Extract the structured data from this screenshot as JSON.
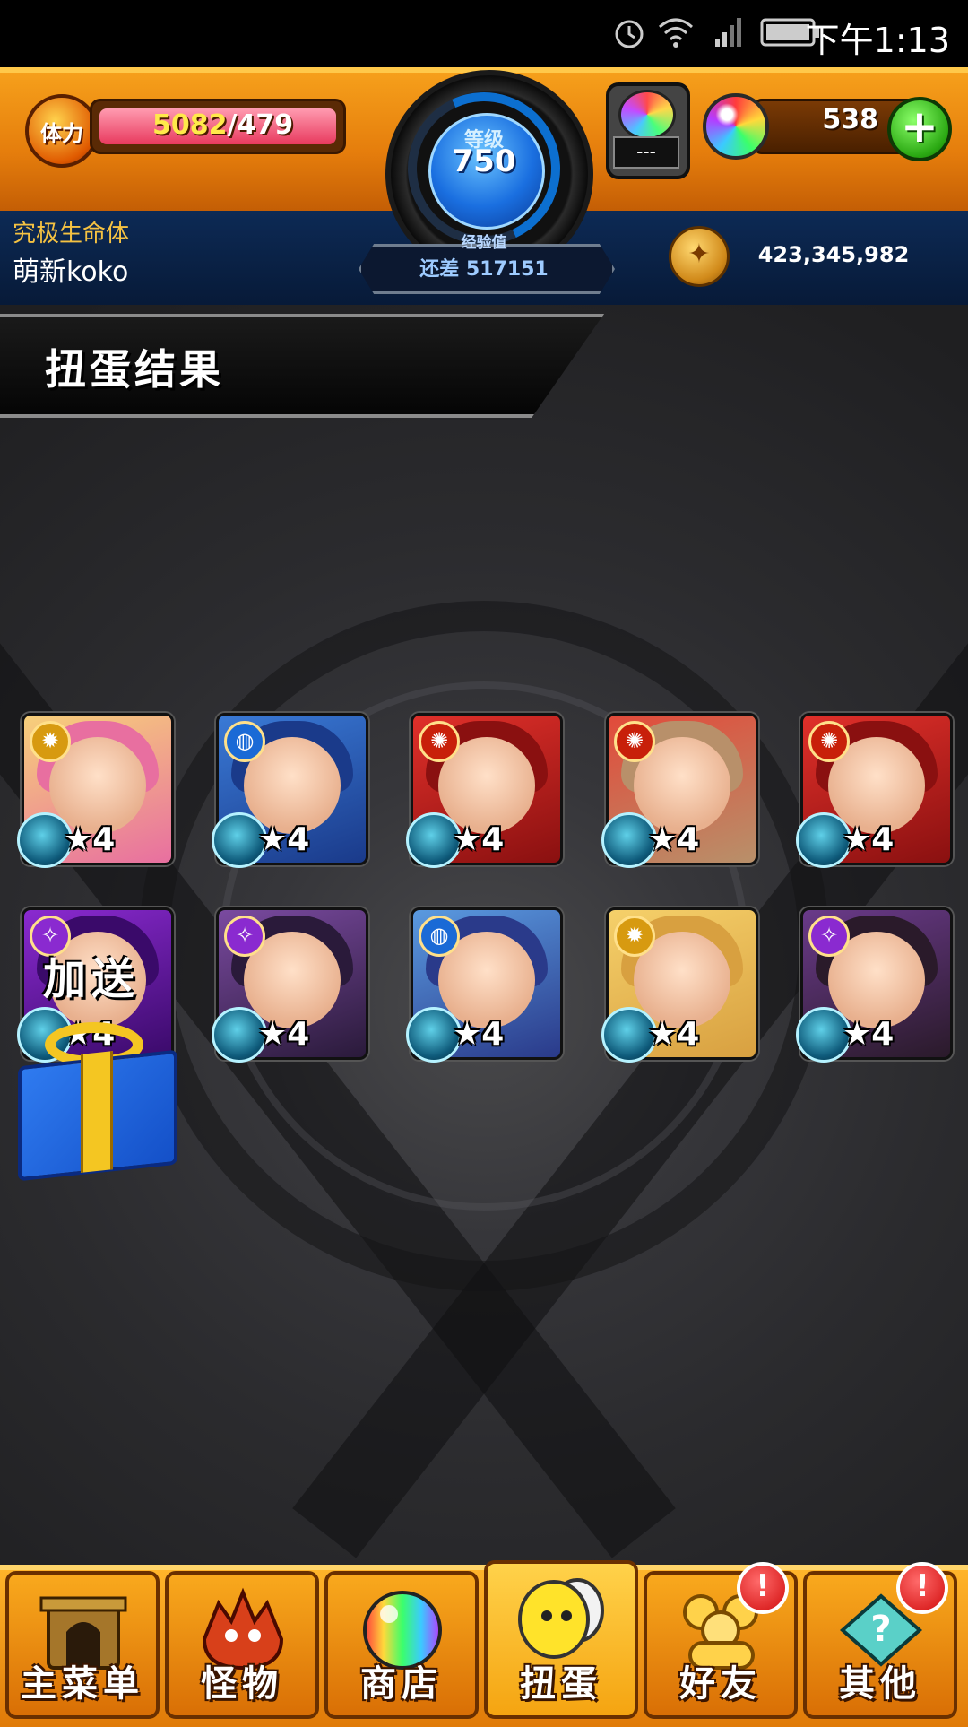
{
  "status_bar": {
    "time": "下午1:13"
  },
  "header": {
    "stamina_icon_label": "体力",
    "stamina_current": "5082",
    "stamina_max": "/479",
    "stamina_fill": 1.0,
    "level_label": "等级",
    "level_value": "750",
    "capsule_display": "---",
    "orb_count": "538",
    "plus_label": "+",
    "exp_label": "经验值",
    "exp_remaining": "还差 517151",
    "rank_title": "究极生命体",
    "player_name": "萌新koko",
    "coin_count": "423,345,982"
  },
  "page": {
    "title": "扭蛋结果",
    "bonus_label": "加送"
  },
  "results": [
    {
      "rarity": "★4",
      "attribute_icon": "light-icon",
      "colors": [
        "#f7d07a",
        "#e86fa0"
      ]
    },
    {
      "rarity": "★4",
      "attribute_icon": "water-icon",
      "colors": [
        "#3a7ad6",
        "#1a3a8a"
      ]
    },
    {
      "rarity": "★4",
      "attribute_icon": "fire-icon",
      "colors": [
        "#e0302a",
        "#8a1010"
      ]
    },
    {
      "rarity": "★4",
      "attribute_icon": "fire-icon",
      "colors": [
        "#e24a3a",
        "#b8906a"
      ]
    },
    {
      "rarity": "★4",
      "attribute_icon": "fire-icon",
      "colors": [
        "#e0302a",
        "#8a1010"
      ]
    },
    {
      "rarity": "★4",
      "attribute_icon": "dark-icon",
      "colors": [
        "#8a2ad0",
        "#3a0a6a"
      ]
    },
    {
      "rarity": "★4",
      "attribute_icon": "dark-icon",
      "colors": [
        "#7a4aa0",
        "#2a1a3a"
      ]
    },
    {
      "rarity": "★4",
      "attribute_icon": "water-icon",
      "colors": [
        "#5a9ae0",
        "#2a3a8a"
      ]
    },
    {
      "rarity": "★4",
      "attribute_icon": "light-icon",
      "colors": [
        "#f5d06a",
        "#d8a040"
      ]
    },
    {
      "rarity": "★4",
      "attribute_icon": "dark-icon",
      "colors": [
        "#6a3a8a",
        "#2a1a2a"
      ]
    }
  ],
  "bottom_nav": [
    {
      "label": "主菜单",
      "icon": "home-gate-icon",
      "alert": ""
    },
    {
      "label": "怪物",
      "icon": "monster-icon",
      "alert": ""
    },
    {
      "label": "商店",
      "icon": "orb-shop-icon",
      "alert": ""
    },
    {
      "label": "扭蛋",
      "icon": "gacha-egg-icon",
      "alert": ""
    },
    {
      "label": "好友",
      "icon": "friends-icon",
      "alert": "!"
    },
    {
      "label": "其他",
      "icon": "other-icon",
      "alert": "!"
    }
  ]
}
